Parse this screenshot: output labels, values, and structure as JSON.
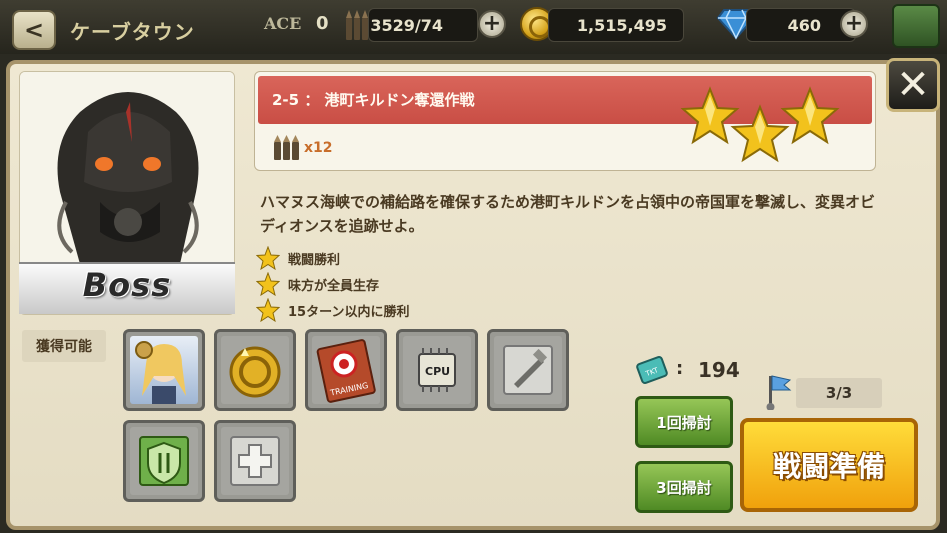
{
  "header": {
    "title": "ケーブタウン",
    "ace_label": "ACE",
    "ace_value": "0",
    "ammo": "3529/74",
    "coins": "1,515,495",
    "gems": "460"
  },
  "boss": {
    "label": "Boss"
  },
  "stage": {
    "title": "2-5 ： 港町キルドン奪還作戦",
    "ammo_cost": "x12",
    "stars": 3
  },
  "description": "ハマヌス海峡での補給路を確保するため港町キルドンを占領中の帝国軍を撃滅し、変異オビディオンスを追跡せよ。",
  "conditions": [
    "戦闘勝利",
    "味方が全員生存",
    "15ターン以内に勝利"
  ],
  "rewards": {
    "label": "獲得可能",
    "items": [
      "character-card",
      "gold-coin",
      "training-book",
      "cpu-chip",
      "weapon-part",
      "armor-shield",
      "medkit-part"
    ]
  },
  "sweep": {
    "ticket_count": "194",
    "attempts": "3/3",
    "sweep1_label": "1回掃討",
    "sweep3_label": "3回掃討",
    "battle_label": "戦闘準備"
  },
  "colors": {
    "banner": "#d25a50",
    "battle_button": "#f7c322",
    "sweep_button": "#6aa536"
  }
}
